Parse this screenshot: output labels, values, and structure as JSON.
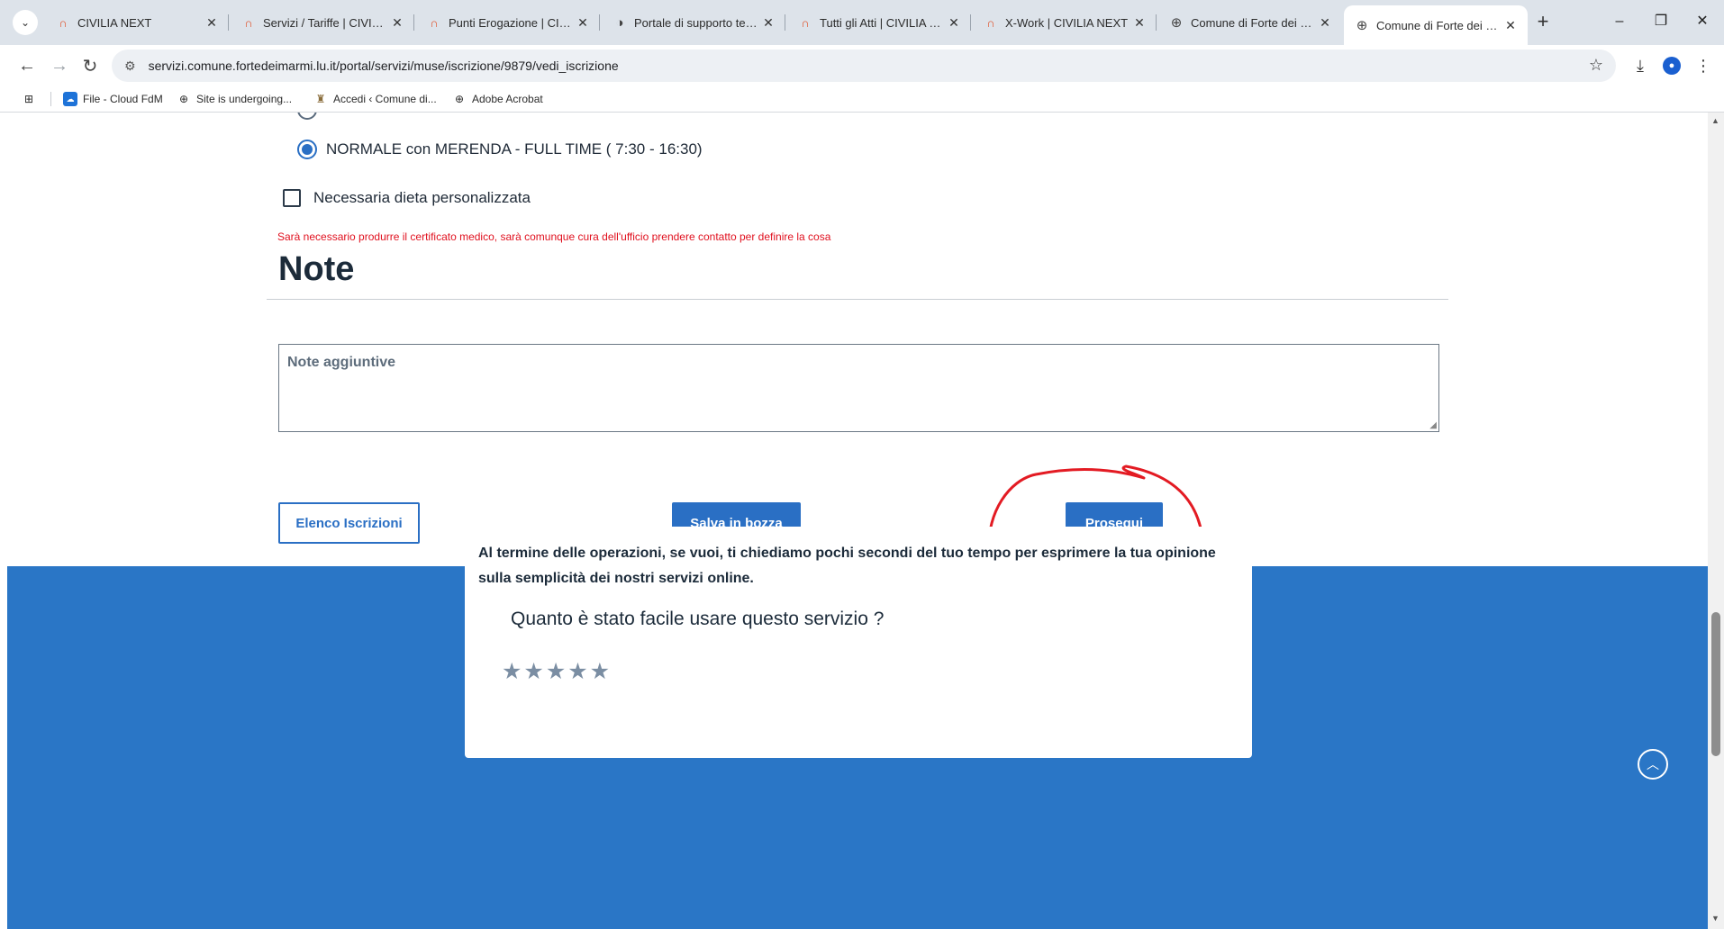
{
  "browser": {
    "tabs": [
      {
        "title": "CIVILIA NEXT",
        "favicon": "civilia-icon"
      },
      {
        "title": "Servizi / Tariffe | CIVILIA N",
        "favicon": "civilia-icon"
      },
      {
        "title": "Punti Erogazione | CIVILIA",
        "favicon": "civilia-icon"
      },
      {
        "title": "Portale di supporto tecnic",
        "favicon": "headset-icon"
      },
      {
        "title": "Tutti gli Atti | CIVILIA NEX",
        "favicon": "civilia-icon"
      },
      {
        "title": "X-Work | CIVILIA NEXT",
        "favicon": "civilia-icon"
      },
      {
        "title": "Comune di Forte dei Mar",
        "favicon": "globe-icon"
      },
      {
        "title": "Comune di Forte dei Mar",
        "favicon": "globe-icon",
        "active": true
      }
    ],
    "url": "servizi.comune.fortedeimarmi.lu.it/portal/servizi/muse/iscrizione/9879/vedi_iscrizione",
    "bookmarks": [
      {
        "label": "File - Cloud FdM",
        "icon": "cloud-icon"
      },
      {
        "label": "Site is undergoing...",
        "icon": "globe-icon"
      },
      {
        "label": "Accedi ‹ Comune di...",
        "icon": "crest-icon"
      },
      {
        "label": "Adobe Acrobat",
        "icon": "globe-icon"
      }
    ]
  },
  "form": {
    "selected_option": "NORMALE con MERENDA - FULL TIME ( 7:30 - 16:30)",
    "diet_checkbox_label": "Necessaria dieta personalizzata",
    "diet_checked": false,
    "warning": "Sarà necessario produrre il certificato medico, sarà comunque cura dell'ufficio prendere contatto per definire la cosa",
    "notes_title": "Note",
    "notes_placeholder": "Note aggiuntive"
  },
  "actions": {
    "list_label": "Elenco Iscrizioni",
    "draft_label": "Salva in bozza",
    "continue_label": "Prosegui"
  },
  "feedback": {
    "intro": "Al termine delle operazioni, se vuoi, ti chiediamo pochi secondi del tuo tempo per esprimere la tua opinione sulla semplicità dei nostri servizi online.",
    "question": "Quanto è stato facile usare questo servizio ?",
    "stars": "★★★★★",
    "rating": 0,
    "max_rating": 5
  },
  "colors": {
    "primary": "#2a6fc4",
    "band": "#2a76c6",
    "warning": "#e0101e",
    "annotation": "#e31b23"
  }
}
